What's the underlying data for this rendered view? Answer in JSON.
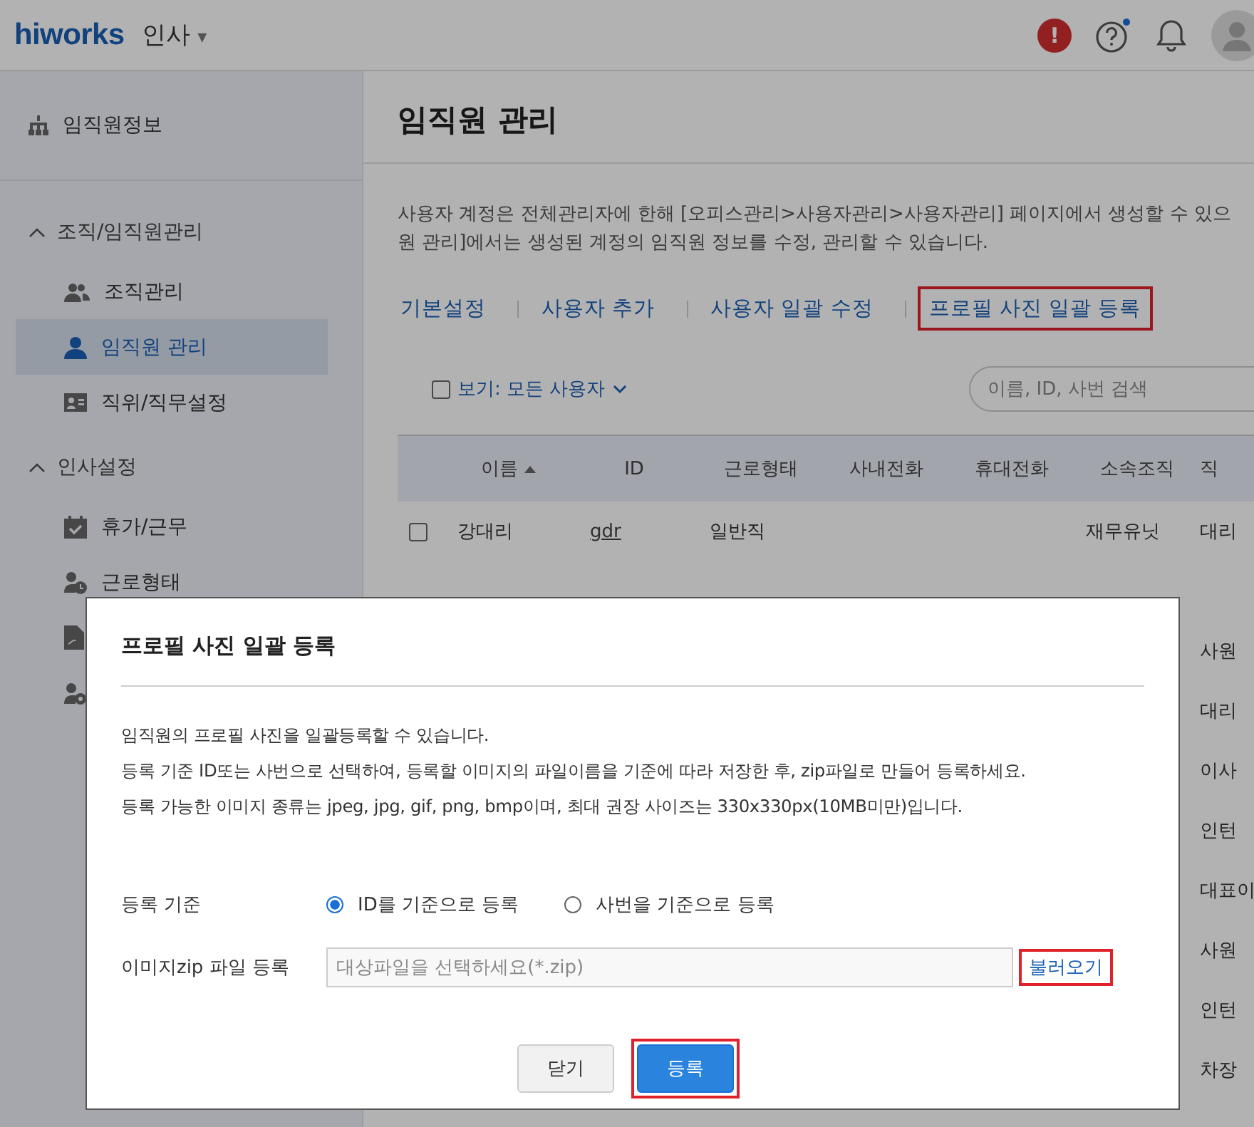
{
  "header": {
    "logo": "hiworks",
    "app_menu": "인사",
    "caret": "▾",
    "notice_badge": "!"
  },
  "sidebar": {
    "top_item": {
      "label": "임직원정보",
      "kind": "org"
    },
    "sections": [
      {
        "title": "조직/임직원관리",
        "expanded": true,
        "items": [
          {
            "label": "조직관리",
            "kind": "people",
            "selected": false
          },
          {
            "label": "임직원 관리",
            "kind": "person",
            "selected": true
          },
          {
            "label": "직위/직무설정",
            "kind": "card",
            "selected": false
          }
        ]
      },
      {
        "title": "인사설정",
        "expanded": true,
        "items": [
          {
            "label": "휴가/근무",
            "kind": "calendar",
            "selected": false
          },
          {
            "label": "근로형태",
            "kind": "clock-person",
            "selected": false
          },
          {
            "kind": "document",
            "selected": false
          },
          {
            "kind": "gear-person",
            "selected": false
          }
        ]
      }
    ]
  },
  "page": {
    "title": "임직원 관리",
    "description": [
      "사용자 계정은 전체관리자에 한해 [오피스관리>사용자관리>사용자관리] 페이지에서 생성할 수 있으",
      "원 관리]에서는 생성된 계정의 임직원 정보를 수정, 관리할 수 있습니다."
    ],
    "tabs": [
      {
        "label": "기본설정",
        "highlighted": false
      },
      {
        "label": "사용자 추가",
        "highlighted": false
      },
      {
        "label": "사용자 일괄 수정",
        "highlighted": false
      },
      {
        "label": "프로필 사진 일괄 등록",
        "highlighted": true
      }
    ],
    "filter": {
      "label": "보기: 모든 사용자",
      "checked": false
    },
    "search": {
      "placeholder": "이름, ID, 사번 검색"
    },
    "table": {
      "columns": [
        {
          "label": "이름",
          "sorted": true
        },
        {
          "label": "ID",
          "sorted": false
        },
        {
          "label": "근로형태",
          "sorted": false
        },
        {
          "label": "사내전화",
          "sorted": false
        },
        {
          "label": "휴대전화",
          "sorted": false
        },
        {
          "label": "소속조직",
          "sorted": false
        },
        {
          "label": "직",
          "sorted": false
        }
      ],
      "rows": [
        {
          "name": "강대리",
          "id": "gdr",
          "work_type": "일반직",
          "org": "재무유닛",
          "position": "대리",
          "checked": false
        },
        {},
        {
          "position": "사원"
        },
        {
          "position": "대리"
        },
        {
          "position": "이사"
        },
        {
          "position": "인턴"
        },
        {
          "position": "대표이"
        },
        {
          "position": "사원"
        },
        {
          "position": "인턴"
        },
        {
          "position": "차장"
        }
      ]
    }
  },
  "dialog": {
    "title": "프로필 사진 일괄 등록",
    "lines": [
      "임직원의 프로필 사진을 일괄등록할 수 있습니다.",
      "등록 기준 ID또는 사번으로 선택하여, 등록할 이미지의 파일이름을 기준에 따라 저장한 후, zip파일로 만들어 등록하세요.",
      "등록 가능한 이미지 종류는 jpeg, jpg, gif, png, bmp이며, 최대 권장 사이즈는 330x330px(10MB미만)입니다."
    ],
    "criteria": {
      "label": "등록 기준",
      "options": [
        {
          "label": "ID를 기준으로 등록",
          "selected": true
        },
        {
          "label": "사번을 기준으로 등록",
          "selected": false
        }
      ]
    },
    "file": {
      "label": "이미지zip 파일 등록",
      "placeholder": "대상파일을 선택하세요(*.zip)",
      "browse": {
        "label": "불러오기",
        "highlighted": true
      }
    },
    "buttons": [
      {
        "label": "닫기",
        "kind": "secondary",
        "highlighted": false
      },
      {
        "label": "등록",
        "kind": "primary",
        "highlighted": true
      }
    ]
  }
}
